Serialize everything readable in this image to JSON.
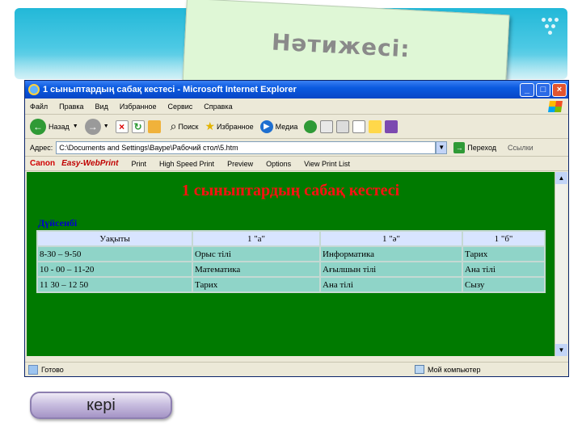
{
  "slide": {
    "title": "Нәтижесі:",
    "back_button": "кері"
  },
  "browser": {
    "window_title": "1 сыныптардың сабақ кестесі - Microsoft Internet Explorer",
    "menu": [
      "Файл",
      "Правка",
      "Вид",
      "Избранное",
      "Сервис",
      "Справка"
    ],
    "toolbar": {
      "back": "Назад",
      "search": "Поиск",
      "favorites": "Избранное",
      "media": "Медиа"
    },
    "address_label": "Адрес:",
    "address_value": "C:\\Documents and Settings\\Вауре\\Рабочий стол\\5.htm",
    "go_label": "Переход",
    "links_label": "Ссылки",
    "printbar": {
      "canon": "Canon",
      "easy_webprint": "Easy-WebPrint",
      "print": "Print",
      "high_speed_print": "High Speed Print",
      "preview": "Preview",
      "options": "Options",
      "view_print_list": "View Print List"
    },
    "status_left": "Готово",
    "status_right": "Мой компьютер"
  },
  "page": {
    "heading": "1 сыныптардың сабақ кестесі",
    "day": "Дүйсенбі",
    "columns": [
      "Уақыты",
      "1 \"а\"",
      "1 \"ә\"",
      "1 \"б\""
    ],
    "rows": [
      [
        "8-30 – 9-50",
        "Орыс тілі",
        "Информатика",
        "Тарих"
      ],
      [
        "10 - 00 – 11-20",
        "Математика",
        "Ағылшын тілі",
        "Ана тілі"
      ],
      [
        "11 30 – 12 50",
        "Тарих",
        "Ана тілі",
        "Сызу"
      ]
    ]
  },
  "colors": {
    "page_background": "#007a00",
    "heading": "#ff1111",
    "day_label": "#0000cc",
    "header_cell": "#d8e4ff",
    "body_cell": "#8fd4c8",
    "slide_band": "#22b8d8",
    "title_card": "#dff7d6"
  }
}
